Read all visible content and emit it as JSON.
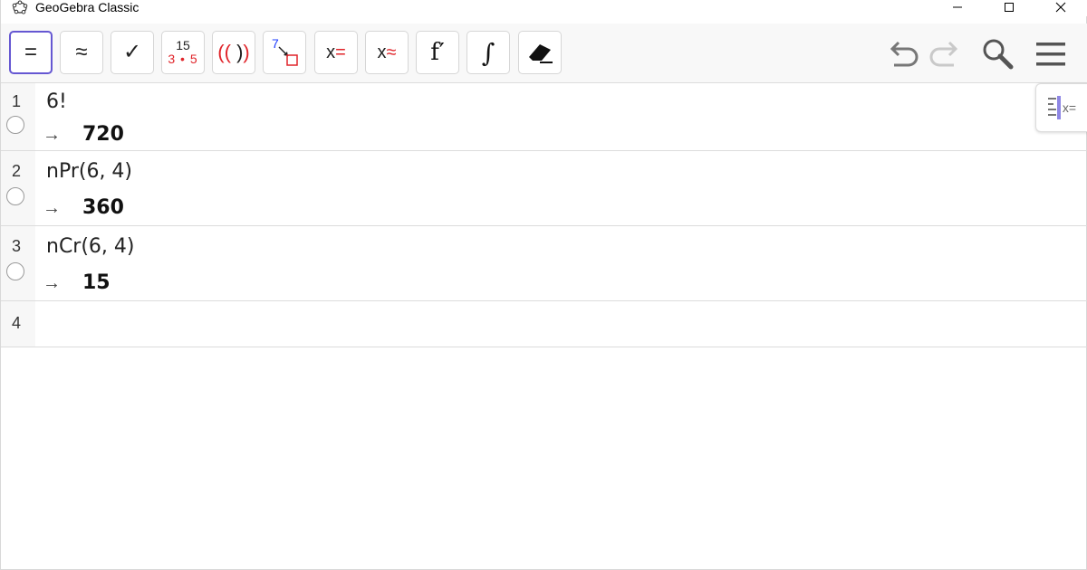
{
  "window": {
    "title": "GeoGebra Classic"
  },
  "toolbar": {
    "buttons": [
      {
        "name": "evaluate",
        "glyph": "=",
        "selected": true
      },
      {
        "name": "numeric",
        "glyph": "≈",
        "selected": false
      },
      {
        "name": "check",
        "glyph": "✓",
        "selected": false
      },
      {
        "name": "factor",
        "numerator": "15",
        "denominator": "3 • 5",
        "selected": false
      },
      {
        "name": "expand",
        "glyph": "(( ))",
        "selected": false
      },
      {
        "name": "substitute",
        "glyph_number": "7",
        "selected": false
      },
      {
        "name": "solve",
        "glyph_x": "x",
        "glyph_op": "=",
        "selected": false
      },
      {
        "name": "solve-numerically",
        "glyph_x": "x",
        "glyph_op": "≈",
        "selected": false
      },
      {
        "name": "derivative",
        "glyph": "f′",
        "selected": false
      },
      {
        "name": "integral",
        "glyph": "∫",
        "selected": false
      },
      {
        "name": "delete",
        "glyph": "eraser",
        "selected": false
      }
    ],
    "right_icons": [
      "undo-icon",
      "redo-icon",
      "search-icon",
      "menu-icon"
    ]
  },
  "algebra": {
    "rows": [
      {
        "index": "1",
        "input": "6!",
        "arrow": "→",
        "output": "720"
      },
      {
        "index": "2",
        "input": "nPr(6, 4)",
        "arrow": "→",
        "output": "360"
      },
      {
        "index": "3",
        "input": "nCr(6, 4)",
        "arrow": "→",
        "output": "15"
      },
      {
        "index": "4",
        "input": "",
        "arrow": "",
        "output": ""
      }
    ]
  },
  "side_panel_toggle": {
    "label": "x="
  },
  "colors": {
    "selected_border": "#6557d2",
    "accent_red": "#e0242a",
    "accent_blue": "#1e3cff",
    "icon_gray": "#555555"
  }
}
